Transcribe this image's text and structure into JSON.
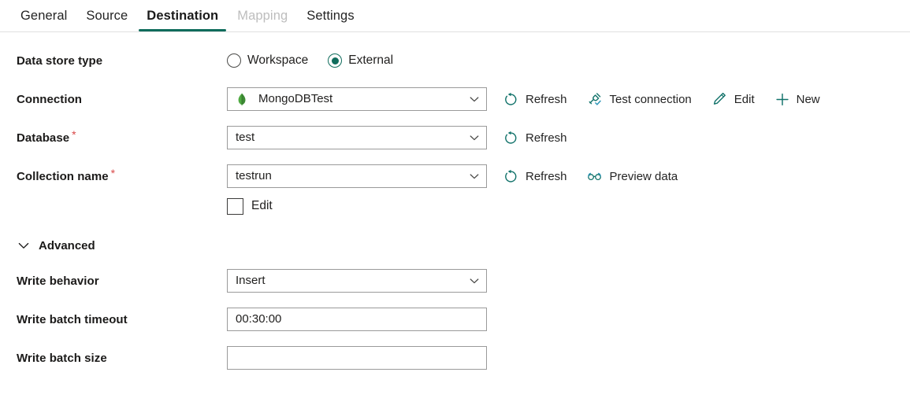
{
  "tabs": [
    {
      "label": "General",
      "state": "normal"
    },
    {
      "label": "Source",
      "state": "normal"
    },
    {
      "label": "Destination",
      "state": "active"
    },
    {
      "label": "Mapping",
      "state": "disabled"
    },
    {
      "label": "Settings",
      "state": "normal"
    }
  ],
  "form": {
    "data_store_type": {
      "label": "Data store type",
      "options": [
        {
          "label": "Workspace",
          "selected": false
        },
        {
          "label": "External",
          "selected": true
        }
      ]
    },
    "connection": {
      "label": "Connection",
      "value": "MongoDBTest",
      "icon": "mongodb-leaf-icon",
      "actions": [
        {
          "label": "Refresh",
          "icon": "refresh-icon"
        },
        {
          "label": "Test connection",
          "icon": "test-connection-icon"
        },
        {
          "label": "Edit",
          "icon": "pencil-icon"
        },
        {
          "label": "New",
          "icon": "plus-icon"
        }
      ]
    },
    "database": {
      "label": "Database",
      "required": "*",
      "value": "test",
      "actions": [
        {
          "label": "Refresh",
          "icon": "refresh-icon"
        }
      ]
    },
    "collection_name": {
      "label": "Collection name",
      "required": "*",
      "value": "testrun",
      "actions": [
        {
          "label": "Refresh",
          "icon": "refresh-icon"
        },
        {
          "label": "Preview data",
          "icon": "glasses-icon"
        }
      ],
      "edit_checkbox": {
        "label": "Edit",
        "checked": false
      }
    },
    "advanced": {
      "label": "Advanced",
      "expanded": true
    },
    "write_behavior": {
      "label": "Write behavior",
      "value": "Insert"
    },
    "write_batch_timeout": {
      "label": "Write batch timeout",
      "value": "00:30:00",
      "placeholder": ""
    },
    "write_batch_size": {
      "label": "Write batch size",
      "value": "",
      "placeholder": ""
    }
  },
  "colors": {
    "accent_teal": "#0f6c5c",
    "icon_teal": "#11726a",
    "required_red": "#d94848",
    "mongo_green": "#4faa41",
    "disabled_gray": "#bdbdbd",
    "border_gray": "#9a9a9a"
  }
}
